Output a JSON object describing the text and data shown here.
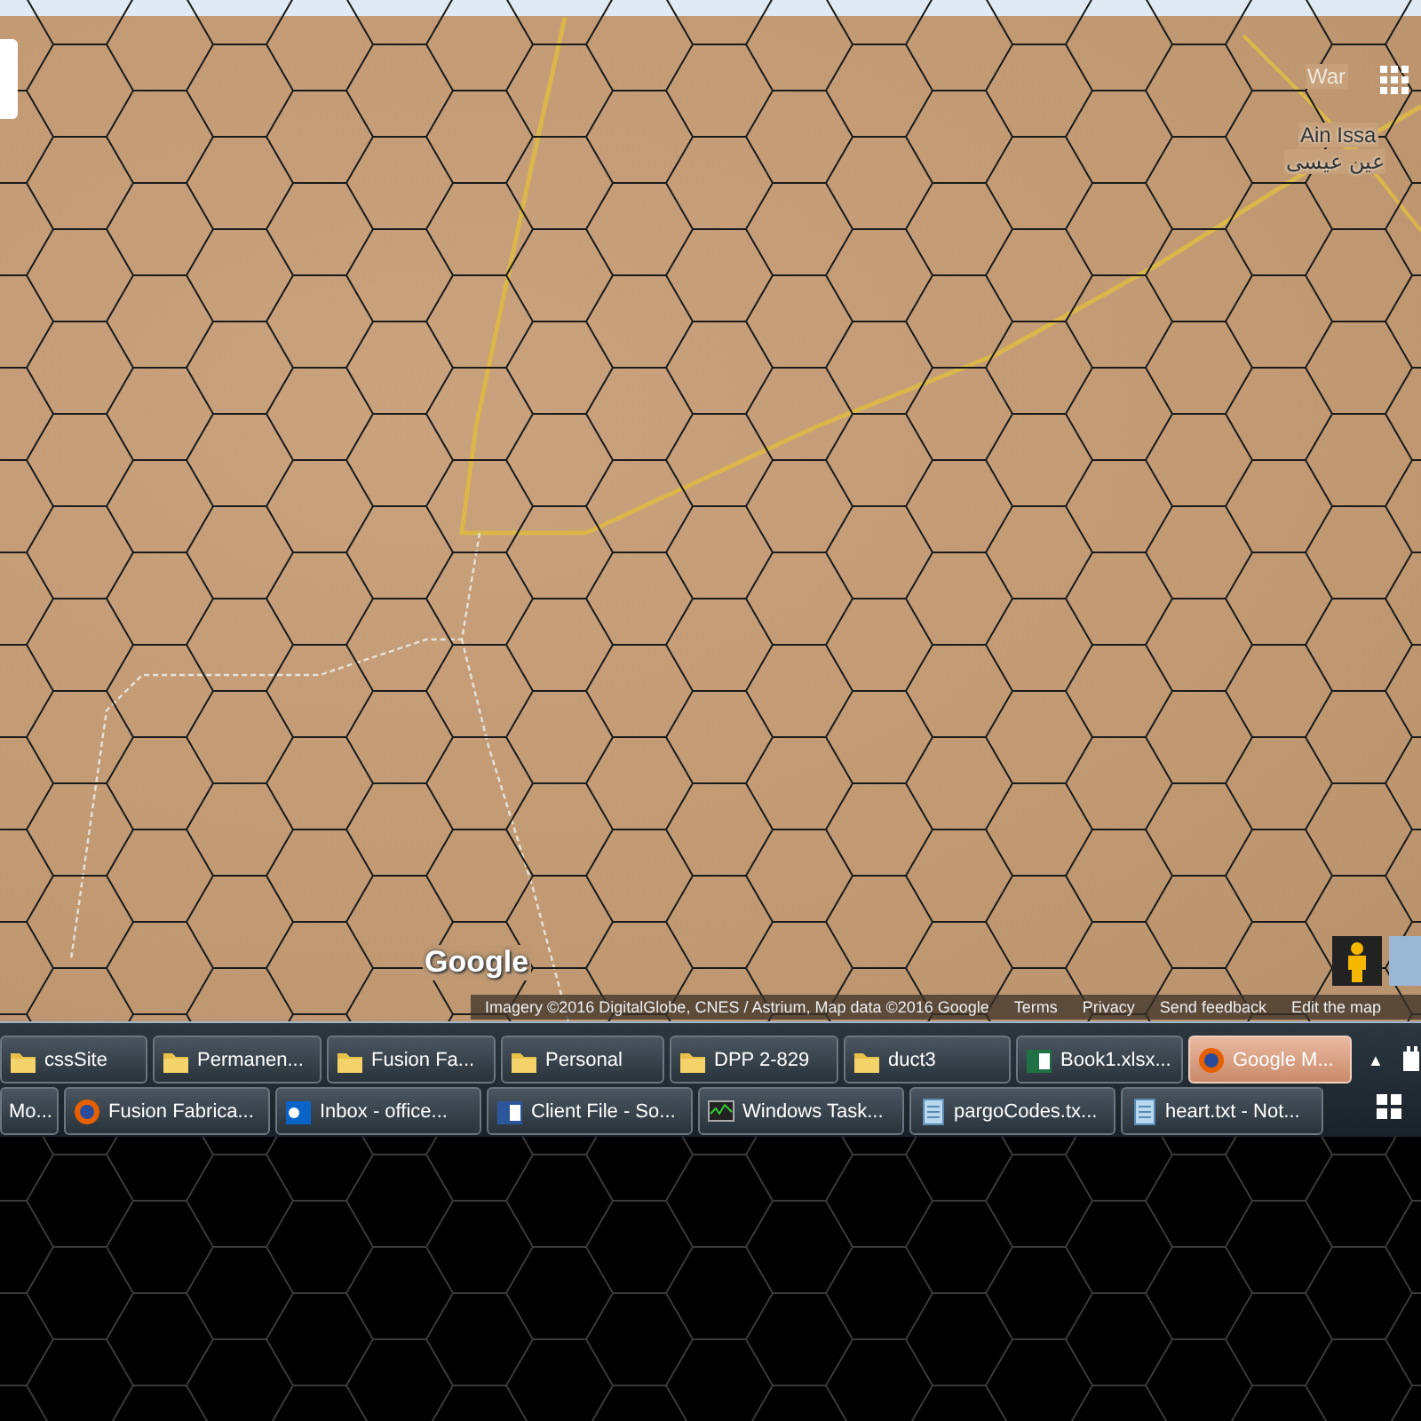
{
  "map": {
    "labels": [
      {
        "kind": "faded",
        "text": "War"
      },
      {
        "kind": "place",
        "text": "Ain Issa"
      },
      {
        "kind": "place",
        "text": "عين عيسى"
      }
    ],
    "logo": "Google",
    "attribution": "Imagery ©2016 DigitalGlobe, CNES / Astrium, Map data ©2016 Google",
    "links": [
      "Terms",
      "Privacy",
      "Send feedback",
      "Edit the map"
    ]
  },
  "taskbar": {
    "top_buttons": [
      {
        "label": "cssSite",
        "kind": "folder",
        "selected": false
      },
      {
        "label": "Permanen...",
        "kind": "folder",
        "selected": false
      },
      {
        "label": "Fusion Fa...",
        "kind": "folder",
        "selected": false
      },
      {
        "label": "Personal",
        "kind": "folder",
        "selected": false
      },
      {
        "label": "DPP 2-829",
        "kind": "folder",
        "selected": false
      },
      {
        "label": "duct3",
        "kind": "folder",
        "selected": false
      },
      {
        "label": "Book1.xlsx...",
        "kind": "spreadsheet",
        "selected": false
      },
      {
        "label": "Google M...",
        "kind": "browser",
        "selected": true
      }
    ],
    "bottom_buttons": [
      {
        "label": "Mo...",
        "kind": "plain",
        "selected": false
      },
      {
        "label": "Fusion Fabrica...",
        "kind": "browser",
        "selected": false
      },
      {
        "label": "Inbox - office...",
        "kind": "mail",
        "selected": false
      },
      {
        "label": "Client File - So...",
        "kind": "document",
        "selected": false
      },
      {
        "label": "Windows Task...",
        "kind": "monitor",
        "selected": false
      },
      {
        "label": "pargoCodes.tx...",
        "kind": "notepad",
        "selected": false
      },
      {
        "label": "heart.txt - Not...",
        "kind": "notepad",
        "selected": false
      }
    ],
    "tray_arrow": "▲"
  }
}
